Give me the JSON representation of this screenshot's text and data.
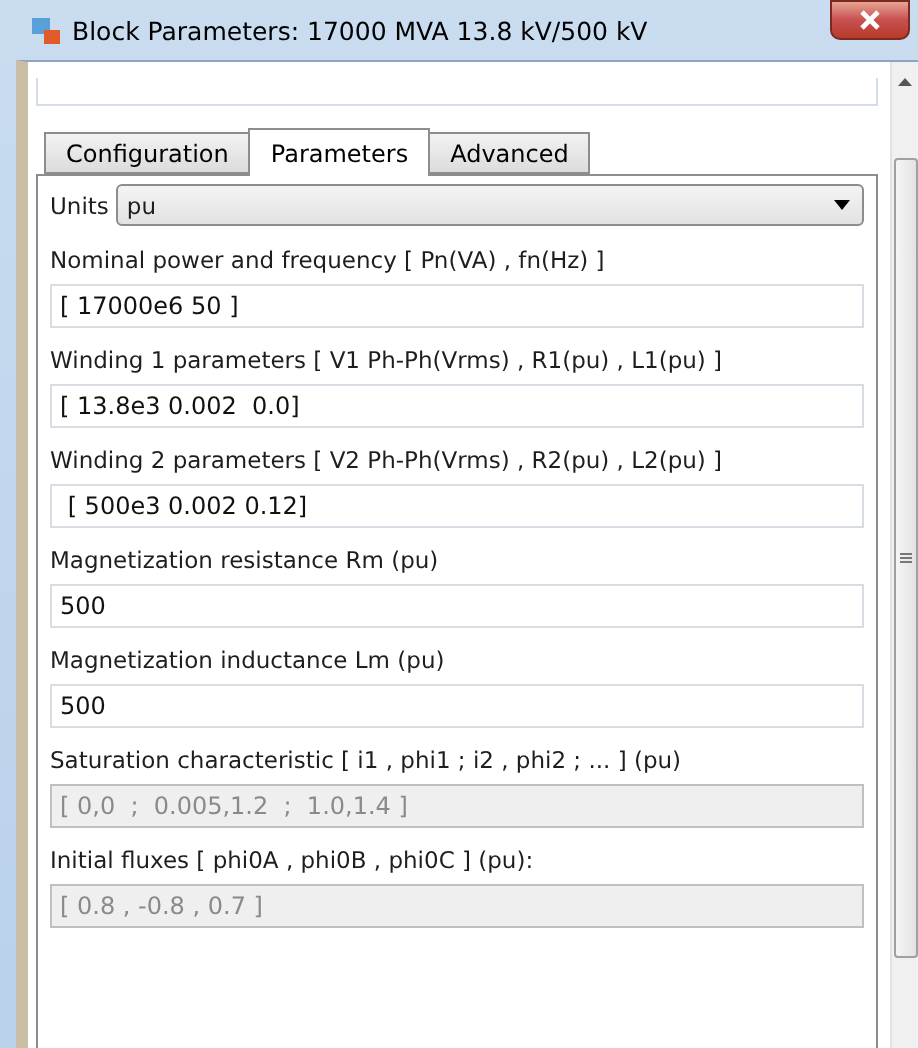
{
  "window": {
    "title": "Block Parameters: 17000 MVA 13.8 kV/500 kV"
  },
  "tabs": [
    {
      "label": "Configuration",
      "selected": false
    },
    {
      "label": "Parameters",
      "selected": true
    },
    {
      "label": "Advanced",
      "selected": false
    }
  ],
  "units": {
    "label": "Units",
    "value": "pu"
  },
  "parameters": [
    {
      "label": "Nominal power and frequency  [ Pn(VA) , fn(Hz) ]",
      "value": "[ 17000e6 50 ]",
      "disabled": false
    },
    {
      "label": "Winding 1 parameters [ V1 Ph-Ph(Vrms) , R1(pu) , L1(pu) ]",
      "value": "[ 13.8e3 0.002  0.0]",
      "disabled": false
    },
    {
      "label": "Winding 2 parameters [ V2 Ph-Ph(Vrms) , R2(pu) , L2(pu) ]",
      "value": " [ 500e3 0.002 0.12]",
      "disabled": false
    },
    {
      "label": "Magnetization resistance  Rm (pu)",
      "value": "500",
      "disabled": false
    },
    {
      "label": "Magnetization inductance  Lm (pu)",
      "value": "500",
      "disabled": false
    },
    {
      "label": "Saturation characteristic [ i1 ,  phi1 ;  i2 , phi2 ; ... ] (pu)",
      "value": "[ 0,0  ;  0.005,1.2  ;  1.0,1.4 ]",
      "disabled": true
    },
    {
      "label": "Initial fluxes [ phi0A , phi0B , phi0C ] (pu):",
      "value": "[ 0.8 , -0.8 , 0.7 ]",
      "disabled": true
    }
  ]
}
